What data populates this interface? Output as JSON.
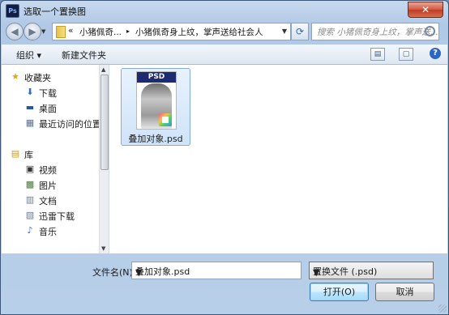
{
  "window": {
    "title": "选取一个置换图",
    "app_icon": "Ps",
    "close_glyph": "✕"
  },
  "address_bar": {
    "overflow": "«",
    "crumbs": [
      "小猪佩奇...",
      "小猪佩奇身上纹，掌声送给社会人"
    ],
    "separator": "▸"
  },
  "search": {
    "placeholder": "搜索 小猪佩奇身上纹，掌声送..."
  },
  "toolbar": {
    "organize_label": "组织 ▾",
    "new_folder_label": "新建文件夹",
    "view_icon": "▤",
    "pane_icon": "▢",
    "help_glyph": "?"
  },
  "nav": {
    "favorites_label": "收藏夹",
    "favorites": [
      "下载",
      "桌面",
      "最近访问的位置"
    ],
    "library_label": "库",
    "libraries": [
      "视频",
      "图片",
      "文档",
      "迅雷下载",
      "音乐"
    ]
  },
  "files": [
    {
      "name": "叠加对象.psd",
      "thumb_label": "PSD",
      "selected": true
    }
  ],
  "bottom": {
    "filename_label": "文件名(N):",
    "filename_value": "叠加对象.psd",
    "filetype_value": "置换文件 (.psd)",
    "open_label": "打开(O)",
    "cancel_label": "取消"
  },
  "colors": {
    "title_bar": "#b9cfe9",
    "close_button": "#c8452c",
    "selection": "#cfe3f9",
    "psd_band": "#1d2b73"
  }
}
